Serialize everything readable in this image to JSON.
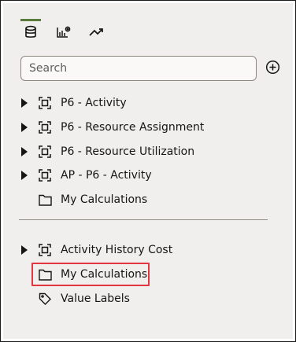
{
  "tabs": [
    {
      "icon": "database-icon",
      "active": true
    },
    {
      "icon": "chart-settings-icon",
      "active": false
    },
    {
      "icon": "trend-icon",
      "active": false
    }
  ],
  "search": {
    "placeholder": "Search"
  },
  "tree_top": [
    {
      "label": "P6 - Activity",
      "icon": "subject-area-icon",
      "expandable": true
    },
    {
      "label": "P6 - Resource Assignment",
      "icon": "subject-area-icon",
      "expandable": true
    },
    {
      "label": "P6 - Resource Utilization",
      "icon": "subject-area-icon",
      "expandable": true
    },
    {
      "label": "AP - P6 - Activity",
      "icon": "subject-area-icon",
      "expandable": true
    },
    {
      "label": "My Calculations",
      "icon": "folder-icon",
      "expandable": false
    }
  ],
  "tree_bottom": [
    {
      "label": "Activity History Cost",
      "icon": "subject-area-icon",
      "expandable": true
    },
    {
      "label": "My Calculations",
      "icon": "folder-icon",
      "expandable": false,
      "highlighted": true
    },
    {
      "label": "Value Labels",
      "icon": "tag-icon",
      "expandable": false
    }
  ],
  "colors": {
    "active_tab": "#5b7b3d",
    "highlight_border": "#e2353f",
    "panel_bg": "#f1efed"
  }
}
